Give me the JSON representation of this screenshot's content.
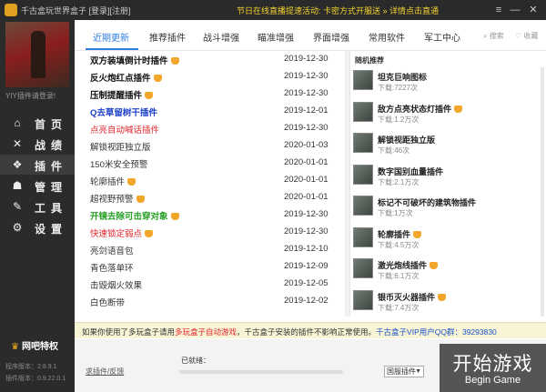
{
  "titlebar": {
    "title": "千古盒玩世界盒子 [登录][注册]",
    "notice": "节日在线直播提速活动: 卡密方式开服送 » 详情点击直通",
    "controls": {
      "menu": "≡",
      "minimize": "—",
      "close": "✕"
    }
  },
  "sidebar": {
    "user_label": "YIY插件请登录!",
    "nav": [
      {
        "label": "首页",
        "icon": "home-icon"
      },
      {
        "label": "战绩",
        "icon": "crossed-swords-icon"
      },
      {
        "label": "插件",
        "icon": "puzzle-icon"
      },
      {
        "label": "管理",
        "icon": "user-manage-icon"
      },
      {
        "label": "工具",
        "icon": "wrench-icon"
      },
      {
        "label": "设置",
        "icon": "gear-icon"
      }
    ],
    "vip_label": "网吧特权",
    "version_line1": "程序版本：2.8.9.1",
    "version_line2": "插件版本：0.9.22.0.1"
  },
  "tabs": [
    "近期更新",
    "推荐插件",
    "战斗增强",
    "瞄准增强",
    "界面增强",
    "常用软件",
    "军工中心"
  ],
  "utilities": {
    "search": "搜索",
    "favorite": "收藏"
  },
  "plugins": [
    {
      "name": "双方装填倒计时插件",
      "date": "2019-12-30",
      "color": "#111111",
      "bold": true,
      "vip": true
    },
    {
      "name": "反火炮红点插件",
      "date": "2019-12-30",
      "color": "#111111",
      "bold": true,
      "vip": true
    },
    {
      "name": "压制提醒插件",
      "date": "2019-12-30",
      "color": "#111111",
      "bold": true,
      "vip": true
    },
    {
      "name": "Q去草留树干插件",
      "date": "2019-12-01",
      "color": "#1a3ec8",
      "bold": true,
      "vip": false
    },
    {
      "name": "点亮自动喊话插件",
      "date": "2019-12-30",
      "color": "#e0242a",
      "bold": false,
      "vip": false
    },
    {
      "name": "解锁视距独立版",
      "date": "2020-01-03",
      "color": "#333333",
      "bold": false,
      "vip": false
    },
    {
      "name": "150米安全预警",
      "date": "2020-01-01",
      "color": "#333333",
      "bold": false,
      "vip": false
    },
    {
      "name": "轮廓插件",
      "date": "2020-01-01",
      "color": "#333333",
      "bold": false,
      "vip": true
    },
    {
      "name": "超视野预警",
      "date": "2020-01-01",
      "color": "#333333",
      "bold": false,
      "vip": true
    },
    {
      "name": "开镜去除可击穿对象",
      "date": "2019-12-30",
      "color": "#28a028",
      "bold": true,
      "vip": true
    },
    {
      "name": "快速锁定弱点",
      "date": "2019-12-30",
      "color": "#e0242a",
      "bold": false,
      "vip": true
    },
    {
      "name": "亮剑语音包",
      "date": "2019-12-10",
      "color": "#333333",
      "bold": false,
      "vip": false
    },
    {
      "name": "青色落单环",
      "date": "2019-12-09",
      "color": "#333333",
      "bold": false,
      "vip": false
    },
    {
      "name": "击毁烟火效果",
      "date": "2019-12-05",
      "color": "#333333",
      "bold": false,
      "vip": false
    },
    {
      "name": "白色断带",
      "date": "2019-12-02",
      "color": "#333333",
      "bold": false,
      "vip": false
    }
  ],
  "random": {
    "title": "随机推荐",
    "items": [
      {
        "name": "坦克巨响图标",
        "downloads": "下载:7227次",
        "vip": false
      },
      {
        "name": "敌方点亮状态灯插件",
        "downloads": "下载:1.2万次",
        "vip": true
      },
      {
        "name": "解锁视距独立版",
        "downloads": "下载:46次",
        "vip": false
      },
      {
        "name": "数字国别血量插件",
        "downloads": "下载:2.1万次",
        "vip": false
      },
      {
        "name": "标记不可破坏的建筑物插件",
        "downloads": "下载:1万次",
        "vip": false
      },
      {
        "name": "轮廓插件",
        "downloads": "下载:4.5万次",
        "vip": true
      },
      {
        "name": "激光炮线插件",
        "downloads": "下载:6.1万次",
        "vip": true
      },
      {
        "name": "银币灭火器插件",
        "downloads": "下载:7.4万次",
        "vip": true
      }
    ]
  },
  "info": {
    "part1": "如果你使用了多玩盒子请用",
    "part2": "多玩盒子自动游戏",
    "part3": "，千古盒子安装的插件不影响正常使用。",
    "part4": "千古盒子VIP用户QQ群：39293830"
  },
  "bottom": {
    "feedback": "求插件/反馈",
    "progress_label": "已就绪：",
    "progress_fraction": 0,
    "server_select": "国服插件",
    "start_cn": "开始游戏",
    "start_en": "Begin Game"
  }
}
